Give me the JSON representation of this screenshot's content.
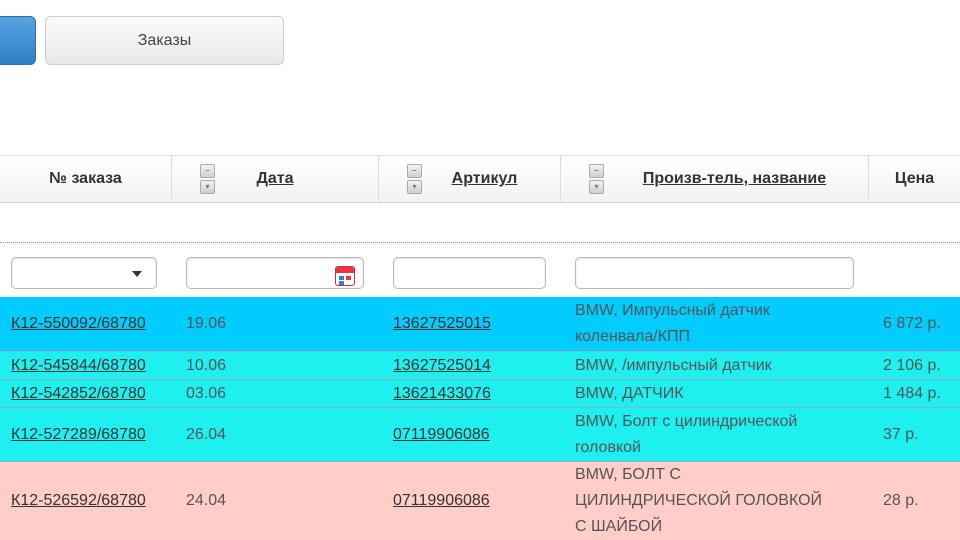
{
  "tabs": {
    "orders_label": "Заказы"
  },
  "columns": {
    "order": "№ заказа",
    "date": "Дата",
    "article": "Артикул",
    "maker": "Произв-тель, название",
    "price": "Цена"
  },
  "colors": {
    "row_active": "#00ccff",
    "row_ok": "#1ef0f0",
    "row_error": "#ffcec8"
  },
  "rows": [
    {
      "order": "К12-550092/68780",
      "date": "19.06",
      "article": "13627525015",
      "name_lines": [
        "BMW, Импульсный датчик",
        "коленвала/КПП"
      ],
      "price": "6 872 р."
    },
    {
      "order": "К12-545844/68780",
      "date": "10.06",
      "article": "13627525014",
      "name_lines": [
        "BMW, /импульсный датчик"
      ],
      "price": "2 106 р."
    },
    {
      "order": "К12-542852/68780",
      "date": "03.06",
      "article": "13621433076",
      "name_lines": [
        "BMW, ДАТЧИК"
      ],
      "price": "1 484 р."
    },
    {
      "order": "К12-527289/68780",
      "date": "26.04",
      "article": "07119906086",
      "name_lines": [
        "BMW, Болт с цилиндрической",
        "головкой"
      ],
      "price": "37 р."
    },
    {
      "order": "К12-526592/68780",
      "date": "24.04",
      "article": "07119906086",
      "name_lines": [
        "BMW, БОЛТ С",
        "ЦИЛИНДРИЧЕСКОЙ ГОЛОВКОЙ",
        "С ШАЙБОЙ"
      ],
      "price": "28 р."
    }
  ]
}
